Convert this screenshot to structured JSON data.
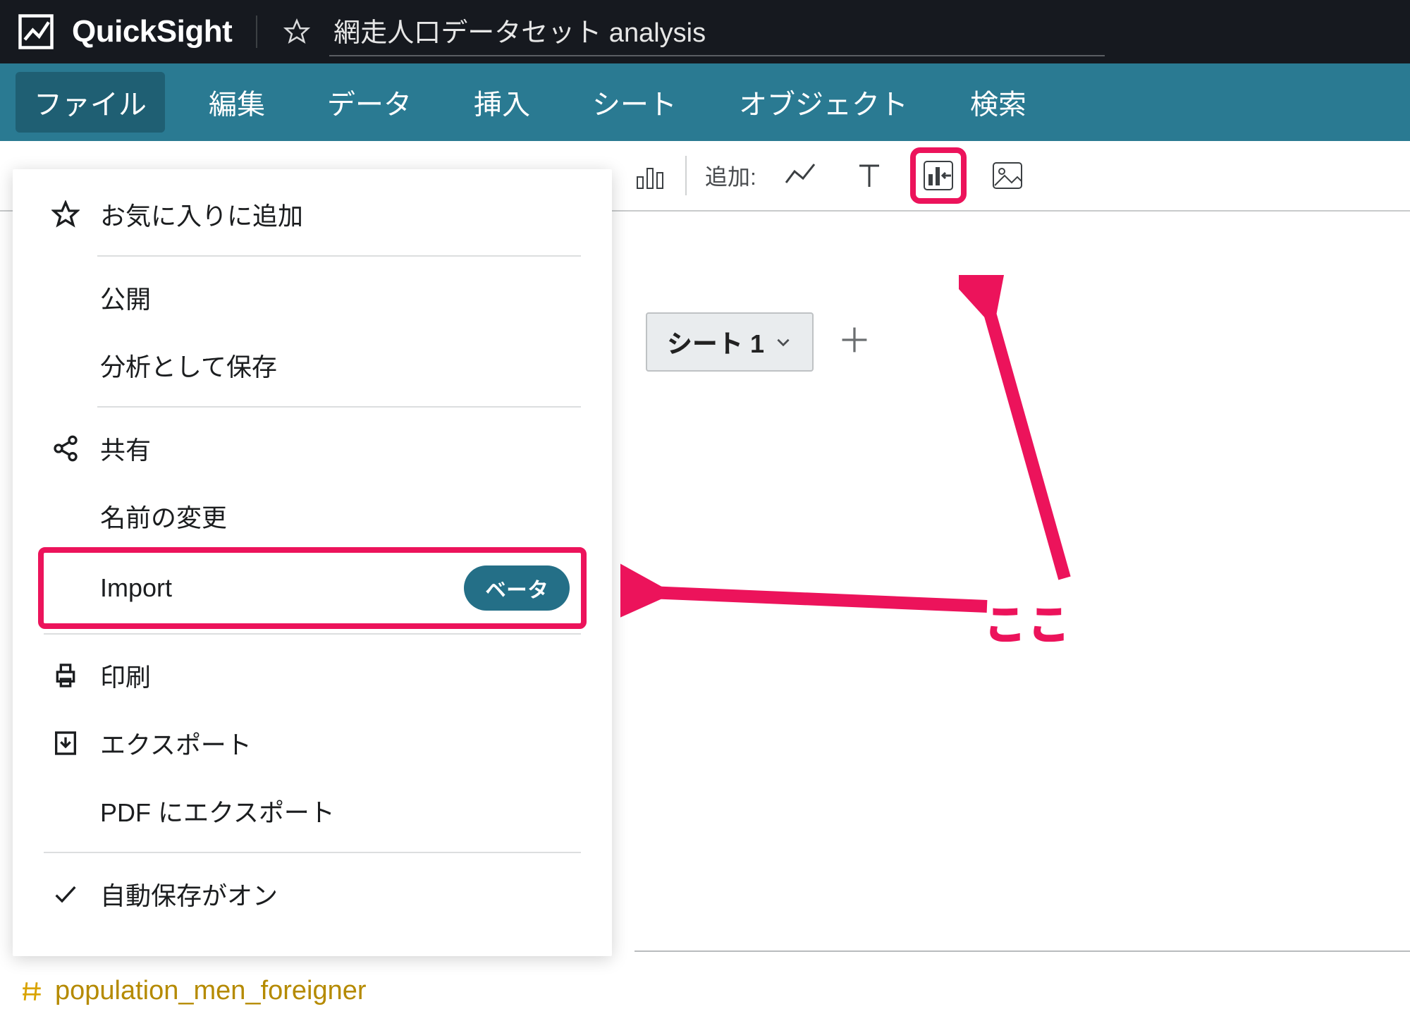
{
  "app": {
    "name": "QuickSight",
    "analysis_title": "網走人口データセット analysis"
  },
  "menubar": {
    "items": [
      "ファイル",
      "編集",
      "データ",
      "挿入",
      "シート",
      "オブジェクト",
      "検索"
    ],
    "active_index": 0
  },
  "toolbar": {
    "add_label": "追加:"
  },
  "sheets": {
    "active": "シート 1"
  },
  "file_menu": {
    "add_favorite": "お気に入りに追加",
    "publish": "公開",
    "save_as_analysis": "分析として保存",
    "share": "共有",
    "rename": "名前の変更",
    "import": "Import",
    "import_badge": "ベータ",
    "print": "印刷",
    "export": "エクスポート",
    "export_pdf": "PDF にエクスポート",
    "autosave": "自動保存がオン"
  },
  "annotation": {
    "label": "ここ"
  },
  "bottom_frag": {
    "text": "population_men_foreigner"
  }
}
